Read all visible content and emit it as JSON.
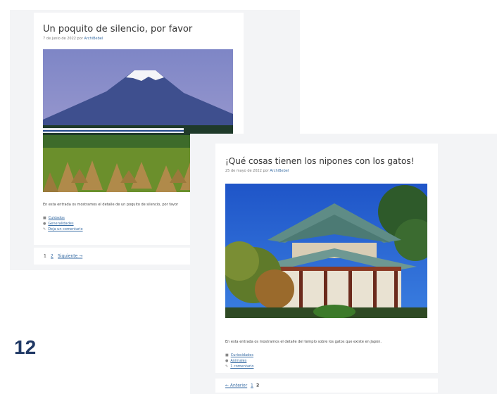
{
  "slide_number": "12",
  "back_post": {
    "title": "Un poquito de silencio, por favor",
    "date": "7 de junio de 2022",
    "by": "por",
    "author": "ArchiBebel",
    "excerpt": "En esta entrada os mostramos el detalle de un poquito de silencio, por favor",
    "footer": {
      "category": "Cuidados",
      "tag": "Generalidades",
      "comments": "Deja un comentario"
    },
    "pager": {
      "page1": "1",
      "page2": "2",
      "next": "Siguiente →"
    },
    "image_alt": "Mount Fuji with bullet train and rice fields"
  },
  "front_post": {
    "title": "¡Qué cosas tienen los nipones con los gatos!",
    "date": "25 de mayo de 2022",
    "by": "por",
    "author": "ArchiBebel",
    "excerpt": "En esta entrada os mostramos el detalle del templo sobre los gatos que existe en Japón.",
    "footer": {
      "category": "Curiosidades",
      "tag": "Animales",
      "comments": "1 comentario"
    },
    "pager": {
      "prev": "← Anterior",
      "page1": "1",
      "page2": "2"
    },
    "image_alt": "Japanese temple with trees"
  },
  "colors": {
    "slide_number": "#1f3864",
    "link": "#3a6ea5",
    "screenshot_bg": "#f3f4f6"
  }
}
